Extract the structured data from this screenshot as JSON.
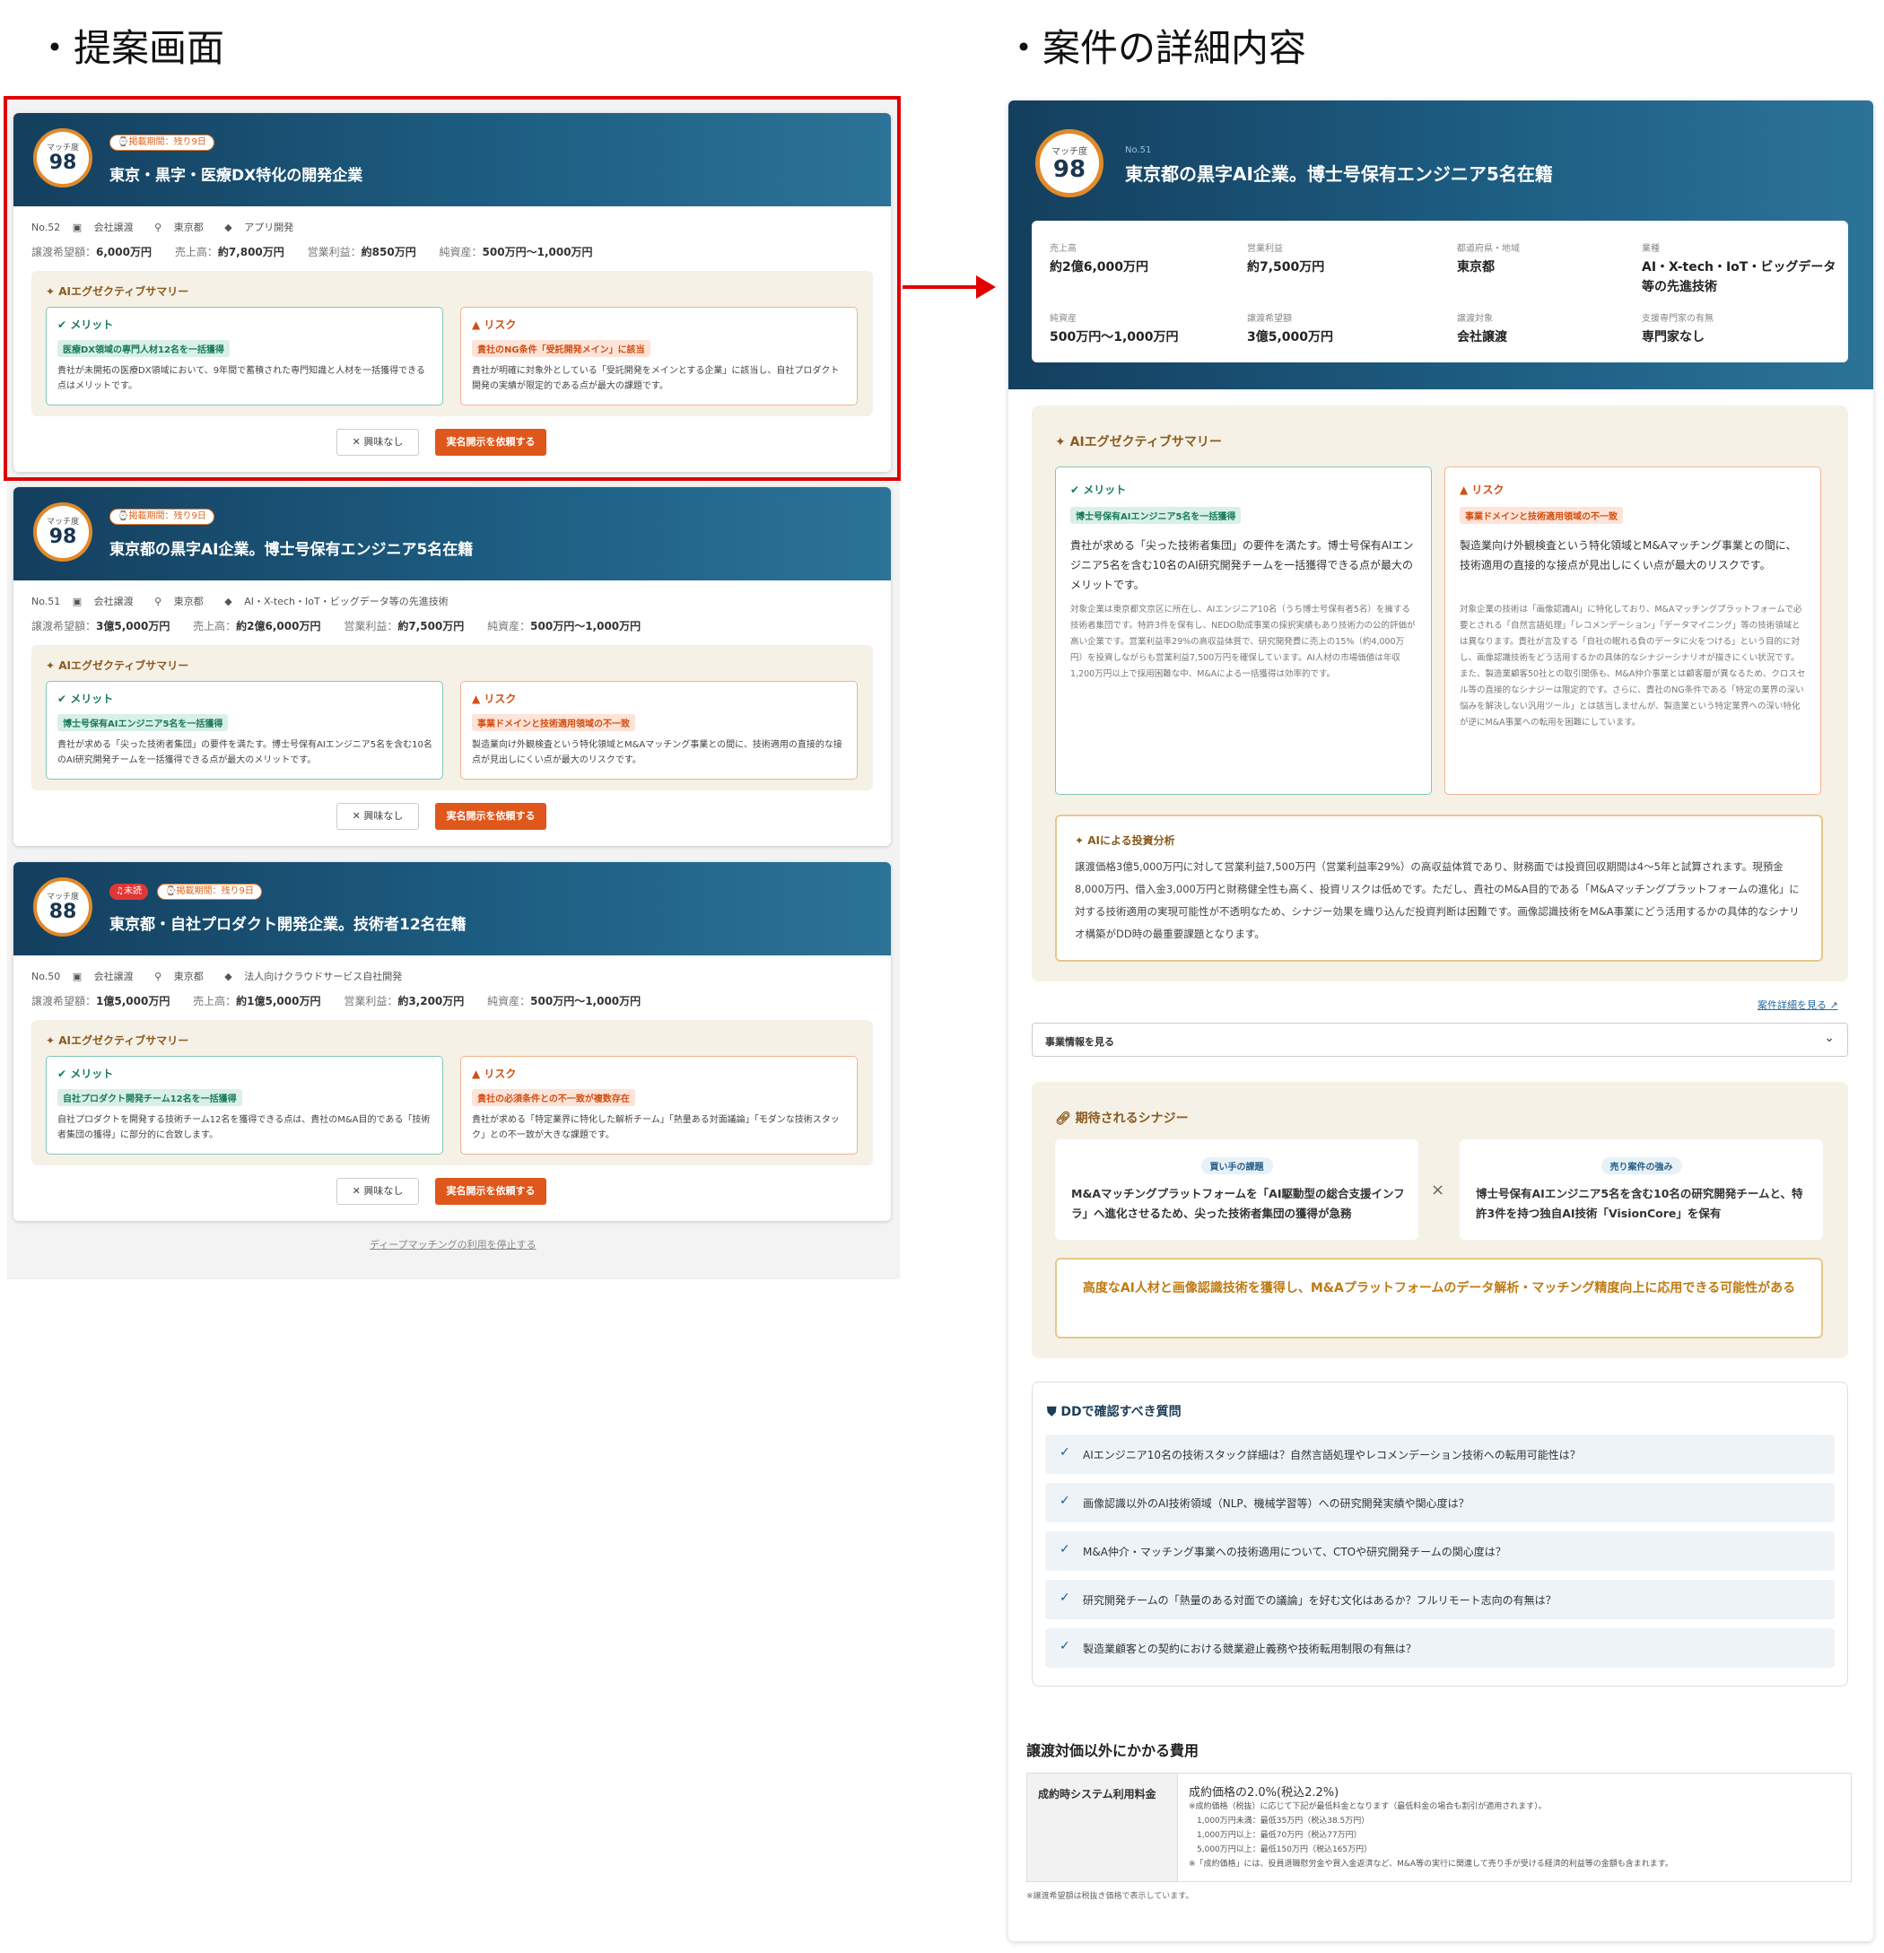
{
  "headings": {
    "left": "・提案画面",
    "right": "・案件の詳細内容"
  },
  "common": {
    "match_label": "マッチ度",
    "ai_summary": "AIエグゼクティブサマリー",
    "merit": "メリット",
    "risk": "リスク",
    "btn_none": "✕ 興味なし",
    "btn_request": "実名開示を依頼する",
    "period_badge": "⌚掲載期間：残り9日",
    "new_badge": "♫未読",
    "fin_labels": {
      "price": "譲渡希望額：",
      "sales": "売上高：",
      "op": "営業利益：",
      "net": "純資産："
    }
  },
  "cards": [
    {
      "score": "98",
      "title": "東京・黒字・医療DX特化の開発企業",
      "no": "No.52",
      "type": "会社譲渡",
      "loc": "東京都",
      "ind": "アプリ開発",
      "price": "6,000万円",
      "sales": "約7,800万円",
      "op": "約850万円",
      "net": "500万円〜1,000万円",
      "merit_tag": "医療DX領域の専門人材12名を一括獲得",
      "merit_text": "貴社が未開拓の医療DX領域において、9年間で蓄積された専門知識と人材を一括獲得できる点はメリットです。",
      "risk_tag": "貴社のNG条件「受託開発メイン」に該当",
      "risk_text": "貴社が明確に対象外としている「受託開発をメインとする企業」に該当し、自社プロダクト開発の実績が限定的である点が最大の課題です。"
    },
    {
      "score": "98",
      "title": "東京都の黒字AI企業。博士号保有エンジニア5名在籍",
      "no": "No.51",
      "type": "会社譲渡",
      "loc": "東京都",
      "ind": "AI・X-tech・IoT・ビッグデータ等の先進技術",
      "price": "3億5,000万円",
      "sales": "約2億6,000万円",
      "op": "約7,500万円",
      "net": "500万円〜1,000万円",
      "merit_tag": "博士号保有AIエンジニア5名を一括獲得",
      "merit_text": "貴社が求める「尖った技術者集団」の要件を満たす。博士号保有AIエンジニア5名を含む10名のAI研究開発チームを一括獲得できる点が最大のメリットです。",
      "risk_tag": "事業ドメインと技術適用領域の不一致",
      "risk_text": "製造業向け外観検査という特化領域とM&Aマッチング事業との間に、技術適用の直接的な接点が見出しにくい点が最大のリスクです。"
    },
    {
      "score": "88",
      "title": "東京都・自社プロダクト開発企業。技術者12名在籍",
      "no": "No.50",
      "type": "会社譲渡",
      "loc": "東京都",
      "ind": "法人向けクラウドサービス自社開発",
      "price": "1億5,000万円",
      "sales": "約1億5,000万円",
      "op": "約3,200万円",
      "net": "500万円〜1,000万円",
      "merit_tag": "自社プロダクト開発チーム12名を一括獲得",
      "merit_text": "自社プロダクトを開発する技術チーム12名を獲得できる点は、貴社のM&A目的である「技術者集団の獲得」に部分的に合致します。",
      "risk_tag": "貴社の必須条件との不一致が複数存在",
      "risk_text": "貴社が求める「特定業界に特化した解析チーム」「熱量ある対面議論」「モダンな技術スタック」との不一致が大きな課題です。"
    }
  ],
  "stop_link": "ディープマッチングの利用を停止する",
  "detail": {
    "score": "98",
    "no": "No.51",
    "title": "東京都の黒字AI企業。博士号保有エンジニア5名在籍",
    "info": [
      {
        "label": "売上高",
        "value": "約2億6,000万円"
      },
      {
        "label": "営業利益",
        "value": "約7,500万円"
      },
      {
        "label": "都道府県・地域",
        "value": "東京都"
      },
      {
        "label": "業種",
        "value": "AI・X-tech・IoT・ビッグデータ等の先進技術"
      },
      {
        "label": "純資産",
        "value": "500万円〜1,000万円"
      },
      {
        "label": "譲渡希望額",
        "value": "3億5,000万円"
      },
      {
        "label": "譲渡対象",
        "value": "会社譲渡"
      },
      {
        "label": "支援専門家の有無",
        "value": "専門家なし"
      }
    ],
    "merit_tag": "博士号保有AIエンジニア5名を一括獲得",
    "merit_main": "貴社が求める「尖った技術者集団」の要件を満たす。博士号保有AIエンジニア5名を含む10名のAI研究開発チームを一括獲得できる点が最大のメリットです。",
    "merit_sub": "対象企業は東京都文京区に所在し、AIエンジニア10名（うち博士号保有者5名）を擁する技術者集団です。特許3件を保有し、NEDO助成事業の採択実績もあり技術力の公的評価が高い企業です。営業利益率29%の高収益体質で、研究開発費に売上の15%（約4,000万円）を投資しながらも営業利益7,500万円を確保しています。AI人材の市場価値は年収1,200万円以上で採用困難な中、M&Aによる一括獲得は効率的です。",
    "risk_tag": "事業ドメインと技術適用領域の不一致",
    "risk_main": "製造業向け外観検査という特化領域とM&Aマッチング事業との間に、技術適用の直接的な接点が見出しにくい点が最大のリスクです。",
    "risk_sub": "対象企業の技術は「画像認識AI」に特化しており、M&Aマッチングプラットフォームで必要とされる「自然言語処理」「レコメンデーション」「データマイニング」等の技術領域とは異なります。貴社が言及する「自社の眠れる負のデータに火をつける」という目的に対し、画像認識技術をどう活用するかの具体的なシナジーシナリオが描きにくい状況です。また、製造業顧客50社との取引関係も、M&A仲介事業とは顧客層が異なるため、クロスセル等の直接的なシナジーは限定的です。さらに、貴社のNG条件である「特定の業界の深い悩みを解決しない汎用ツール」とは該当しませんが、製造業という特定業界への深い特化が逆にM&A事業への転用を困難にしています。",
    "invest_label": "AIによる投資分析",
    "invest_text": "譲渡価格3億5,000万円に対して営業利益7,500万円（営業利益率29%）の高収益体質であり、財務面では投資回収期間は4〜5年と試算されます。現預金8,000万円、借入金3,000万円と財務健全性も高く、投資リスクは低めです。ただし、貴社のM&A目的である「M&Aマッチングプラットフォームの進化」に対する技術適用の実現可能性が不透明なため、シナジー効果を織り込んだ投資判断は困難です。画像認識技術をM&A事業にどう活用するかの具体的なシナリオ構築がDD時の最重要課題となります。",
    "detail_link": "案件詳細を見る ↗",
    "dropdown": "事業情報を見る",
    "synergy_label": "期待されるシナジー",
    "buyer_tag": "買い手の課題",
    "buyer_text": "M&Aマッチングプラットフォームを「AI駆動型の総合支援インフラ」へ進化させるため、尖った技術者集団の獲得が急務",
    "seller_tag": "売り案件の強み",
    "seller_text": "博士号保有AIエンジニア5名を含む10名の研究開発チームと、特許3件を持つ独自AI技術「VisionCore」を保有",
    "times": "×",
    "conclusion": "高度なAI人材と画像認識技術を獲得し、M&Aプラットフォームのデータ解析・マッチング精度向上に応用できる可能性がある",
    "dd_label": "DDで確認すべき質問",
    "questions": [
      "AIエンジニア10名の技術スタック詳細は？自然言語処理やレコメンデーション技術への転用可能性は？",
      "画像認識以外のAI技術領域（NLP、機械学習等）への研究開発実績や関心度は？",
      "M&A仲介・マッチング事業への技術適用について、CTOや研究開発チームの関心度は？",
      "研究開発チームの「熱量のある対面での議論」を好む文化はあるか？フルリモート志向の有無は？",
      "製造業顧客との契約における競業避止義務や技術転用制限の有無は？"
    ],
    "fee_title": "譲渡対価以外にかかる費用",
    "fee_th": "成約時システム利用料金",
    "fee_main": "成約価格の2.0%(税込2.2%)",
    "fee_lines": [
      "※成約価格（税抜）に応じて下記が最低料金となります（最低料金の場合も割引が適用されます）。",
      "　1,000万円未満：最低35万円（税込38.5万円）",
      "　1,000万円以上：最低70万円（税込77万円）",
      "　5,000万円以上：最低150万円（税込165万円）",
      "※「成約価格」には、役員退職慰労金や買入金返済など、M&A等の実行に関連して売り手が受ける経済的利益等の金額も含まれます。"
    ],
    "fee_note": "※譲渡希望額は税抜き価格で表示しています。"
  }
}
